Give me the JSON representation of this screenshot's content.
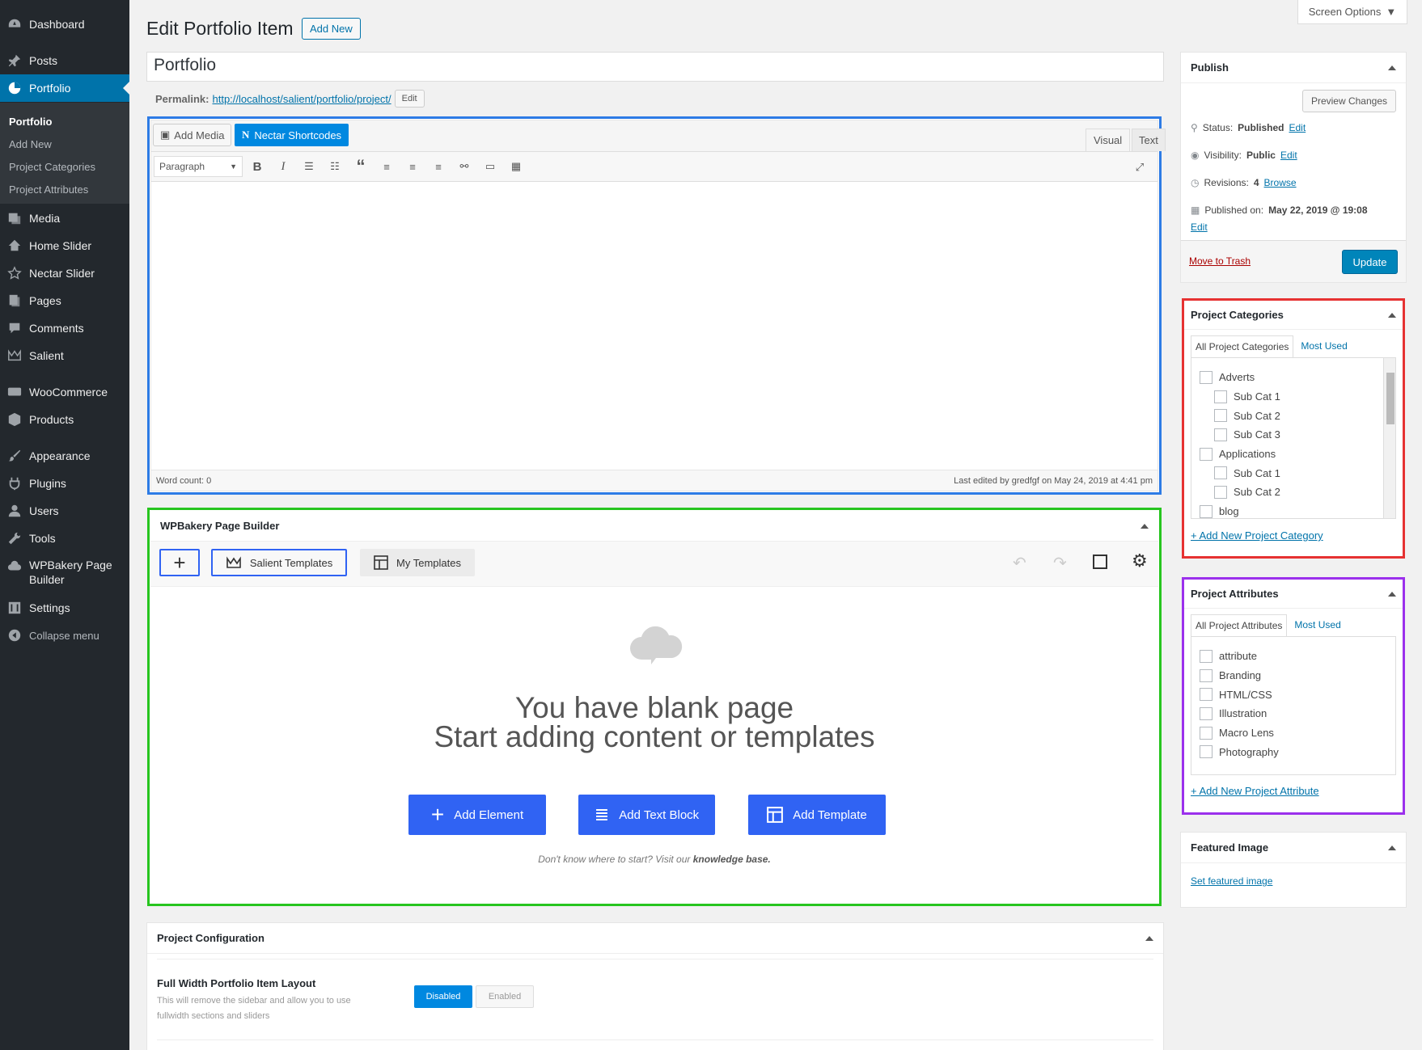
{
  "sidebar": {
    "items": [
      {
        "label": "Dashboard",
        "icon": "dashboard-icon"
      },
      {
        "label": "Posts",
        "icon": "pin-icon"
      },
      {
        "label": "Portfolio",
        "icon": "portfolio-icon"
      },
      {
        "label": "Media",
        "icon": "media-icon"
      },
      {
        "label": "Home Slider",
        "icon": "home-icon"
      },
      {
        "label": "Nectar Slider",
        "icon": "star-icon"
      },
      {
        "label": "Pages",
        "icon": "pages-icon"
      },
      {
        "label": "Comments",
        "icon": "comment-icon"
      },
      {
        "label": "Salient",
        "icon": "crown-icon"
      },
      {
        "label": "WooCommerce",
        "icon": "woo-icon"
      },
      {
        "label": "Products",
        "icon": "box-icon"
      },
      {
        "label": "Appearance",
        "icon": "brush-icon"
      },
      {
        "label": "Plugins",
        "icon": "plug-icon"
      },
      {
        "label": "Users",
        "icon": "user-icon"
      },
      {
        "label": "Tools",
        "icon": "wrench-icon"
      },
      {
        "label": "WPBakery Page Builder",
        "icon": "cloud-icon"
      },
      {
        "label": "Settings",
        "icon": "settings-icon"
      },
      {
        "label": "Collapse menu",
        "icon": "collapse-icon"
      }
    ],
    "submenu": [
      "Portfolio",
      "Add New",
      "Project Categories",
      "Project Attributes"
    ]
  },
  "header": {
    "title": "Edit Portfolio Item",
    "add_new": "Add New",
    "screen_options": "Screen Options"
  },
  "post": {
    "title": "Portfolio",
    "permalink_label": "Permalink:",
    "permalink_url": "http://localhost/salient/portfolio/project/",
    "permalink_edit": "Edit"
  },
  "editor": {
    "add_media": "Add Media",
    "nectar_shortcodes": "Nectar Shortcodes",
    "tab_visual": "Visual",
    "tab_text": "Text",
    "format": "Paragraph",
    "word_count": "Word count: 0",
    "last_edited": "Last edited by gredfgf on May 24, 2019 at 4:41 pm"
  },
  "builder": {
    "title": "WPBakery Page Builder",
    "salient_templates": "Salient Templates",
    "my_templates": "My Templates",
    "blank_line1": "You have blank page",
    "blank_line2": "Start adding content or templates",
    "add_element": "Add Element",
    "add_text_block": "Add Text Block",
    "add_template": "Add Template",
    "help_text": "Don't know where to start? Visit our",
    "help_link": "knowledge base."
  },
  "config": {
    "title": "Project Configuration",
    "option_label": "Full Width Portfolio Item Layout",
    "option_desc": "This will remove the sidebar and allow you to use fullwidth sections and sliders",
    "disabled": "Disabled",
    "enabled": "Enabled"
  },
  "publish": {
    "title": "Publish",
    "preview": "Preview Changes",
    "status_label": "Status:",
    "status_value": "Published",
    "visibility_label": "Visibility:",
    "visibility_value": "Public",
    "revisions_label": "Revisions:",
    "revisions_value": "4",
    "revisions_link": "Browse",
    "published_label": "Published on:",
    "published_value": "May 22, 2019 @ 19:08",
    "edit": "Edit",
    "trash": "Move to Trash",
    "update": "Update"
  },
  "categories": {
    "title": "Project Categories",
    "tab_all": "All Project Categories",
    "tab_most": "Most Used",
    "items": [
      {
        "label": "Adverts",
        "level": 0
      },
      {
        "label": "Sub Cat 1",
        "level": 1
      },
      {
        "label": "Sub Cat 2",
        "level": 1
      },
      {
        "label": "Sub Cat 3",
        "level": 1
      },
      {
        "label": "Applications",
        "level": 0
      },
      {
        "label": "Sub Cat 1",
        "level": 1
      },
      {
        "label": "Sub Cat 2",
        "level": 1
      },
      {
        "label": "blog",
        "level": 0
      }
    ],
    "add_link": "+ Add New Project Category"
  },
  "attributes": {
    "title": "Project Attributes",
    "tab_all": "All Project Attributes",
    "tab_most": "Most Used",
    "items": [
      "attribute",
      "Branding",
      "HTML/CSS",
      "Illustration",
      "Macro Lens",
      "Photography"
    ],
    "add_link": "+ Add New Project Attribute"
  },
  "featured": {
    "title": "Featured Image",
    "link": "Set featured image"
  },
  "colors": {
    "wp_blue": "#0073aa",
    "builder_blue": "#3063f3",
    "highlight_blue": "#2d7be5",
    "highlight_green": "#27c51f",
    "highlight_red": "#e63232",
    "highlight_purple": "#9b30ec",
    "sidebar_dark": "#23282d"
  }
}
